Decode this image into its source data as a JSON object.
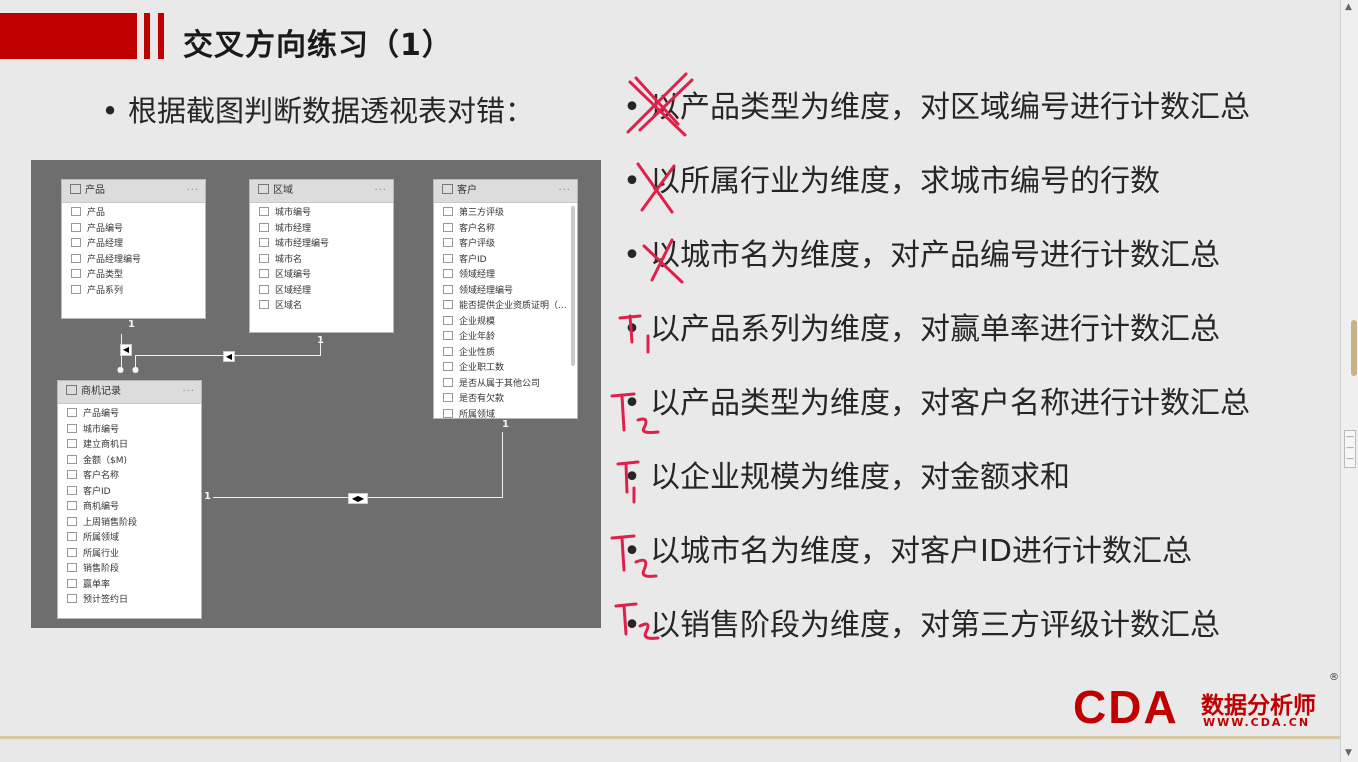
{
  "slide": {
    "title": "交叉方向练习（1）",
    "lead": "根据截图判断数据透视表对错：",
    "bullet": "•",
    "questions": [
      {
        "text": "以产品类型为维度，对区域编号进行计数汇总",
        "mark": "X"
      },
      {
        "text": "以所属行业为维度，求城市编号的行数",
        "mark": "X"
      },
      {
        "text": "以城市名为维度，对产品编号进行计数汇总",
        "mark": "X"
      },
      {
        "text": "以产品系列为维度，对赢单率进行计数汇总",
        "mark": "T1"
      },
      {
        "text": "以产品类型为维度，对客户名称进行计数汇总",
        "mark": "T2"
      },
      {
        "text": "以企业规模为维度，对金额求和",
        "mark": "T1"
      },
      {
        "text": "以城市名为维度，对客户ID进行计数汇总",
        "mark": "T2"
      },
      {
        "text": "以销售阶段为维度，对第三方评级计数汇总",
        "mark": "T2"
      }
    ]
  },
  "diagram": {
    "tables": {
      "product": {
        "name": "产品",
        "more": "···",
        "fields": [
          "产品",
          "产品编号",
          "产品经理",
          "产品经理编号",
          "产品类型",
          "产品系列"
        ]
      },
      "region": {
        "name": "区域",
        "more": "···",
        "fields": [
          "城市编号",
          "城市经理",
          "城市经理编号",
          "城市名",
          "区域编号",
          "区域经理",
          "区域名"
        ]
      },
      "customer": {
        "name": "客户",
        "more": "···",
        "fields": [
          "第三方评级",
          "客户名称",
          "客户评级",
          "客户ID",
          "领域经理",
          "领域经理编号",
          "能否提供企业资质证明（...",
          "企业规模",
          "企业年龄",
          "企业性质",
          "企业职工数",
          "是否从属于其他公司",
          "是否有欠款",
          "所属领域"
        ]
      },
      "opportunity": {
        "name": "商机记录",
        "more": "···",
        "fields": [
          "产品编号",
          "城市编号",
          "建立商机日",
          "金额（$M)",
          "客户名称",
          "客户ID",
          "商机编号",
          "上周销售阶段",
          "所属领域",
          "所属行业",
          "销售阶段",
          "赢单率",
          "预计签约日"
        ]
      }
    },
    "cardinality": {
      "one": "1"
    }
  },
  "logo": {
    "cda": "CDA",
    "cn": "数据分析师",
    "url": "WWW.CDA.CN",
    "reg": "®"
  },
  "colors": {
    "accent": "#c00000",
    "ink_mark": "#e0204a"
  }
}
